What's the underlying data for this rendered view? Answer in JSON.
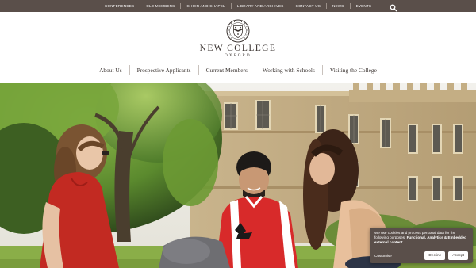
{
  "topbar": {
    "links": [
      "CONFERENCES",
      "OLD MEMBERS",
      "CHOIR AND CHAPEL",
      "LIBRARY AND ARCHIVES",
      "CONTACT US",
      "NEWS",
      "EVENTS"
    ],
    "search_icon": "search-icon"
  },
  "logo": {
    "title": "NEW COLLEGE",
    "subtitle": "OXFORD",
    "crest_icon": "college-crest"
  },
  "nav": {
    "items": [
      "About Us",
      "Prospective Applicants",
      "Current Members",
      "Working with Schools",
      "Visiting the College"
    ]
  },
  "cookie": {
    "text_intro": "We use cookies and process personal data for the following purposes:",
    "text_purposes": "Functional, Analytics & Embedded external content.",
    "customise_label": "Customise",
    "decline_label": "Decline",
    "accept_label": "Accept"
  },
  "colors": {
    "topbar_bg": "#5a4f4a",
    "text_dark": "#3a3330",
    "cookie_bg": "#5a4f4a"
  }
}
